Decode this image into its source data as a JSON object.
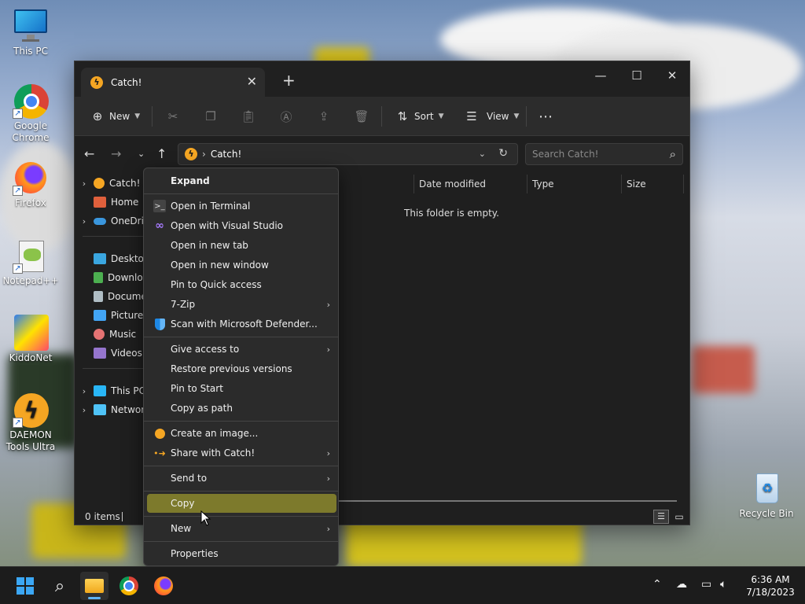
{
  "desktop": {
    "icons": [
      {
        "label": "This PC"
      },
      {
        "label": "Google Chrome"
      },
      {
        "label": "Firefox"
      },
      {
        "label": "Notepad++"
      },
      {
        "label": "KiddoNet"
      },
      {
        "label": "DAEMON Tools Ultra"
      },
      {
        "label": "Recycle Bin"
      }
    ]
  },
  "window": {
    "tab_title": "Catch!",
    "toolbar": {
      "new_label": "New",
      "sort_label": "Sort",
      "view_label": "View"
    },
    "address": {
      "path": "Catch!",
      "search_placeholder": "Search Catch!"
    },
    "nav": {
      "items": [
        {
          "label": "Catch!"
        },
        {
          "label": "Home"
        },
        {
          "label": "OneDriv"
        },
        {
          "label": "Desktop"
        },
        {
          "label": "Downlo"
        },
        {
          "label": "Docume"
        },
        {
          "label": "Pictures"
        },
        {
          "label": "Music"
        },
        {
          "label": "Videos"
        },
        {
          "label": "This PC"
        },
        {
          "label": "Networ"
        }
      ]
    },
    "columns": {
      "date_modified": "Date modified",
      "type": "Type",
      "size": "Size"
    },
    "empty_message": "This folder is empty.",
    "status": {
      "item_count": "0 items"
    }
  },
  "context_menu": {
    "items": [
      {
        "label": "Expand"
      },
      {
        "label": "Open in Terminal"
      },
      {
        "label": "Open with Visual Studio"
      },
      {
        "label": "Open in new tab"
      },
      {
        "label": "Open in new window"
      },
      {
        "label": "Pin to Quick access"
      },
      {
        "label": "7-Zip"
      },
      {
        "label": "Scan with Microsoft Defender..."
      },
      {
        "label": "Give access to"
      },
      {
        "label": "Restore previous versions"
      },
      {
        "label": "Pin to Start"
      },
      {
        "label": "Copy as path"
      },
      {
        "label": "Create an image..."
      },
      {
        "label": "Share with Catch!"
      },
      {
        "label": "Send to"
      },
      {
        "label": "Copy"
      },
      {
        "label": "New"
      },
      {
        "label": "Properties"
      }
    ]
  },
  "taskbar": {
    "time": "6:36 AM",
    "date": "7/18/2023"
  },
  "colors": {
    "accent_highlight": "#7d7a2c",
    "window_bg": "#1f1f1f",
    "menu_bg": "#2b2b2b",
    "catch_orange": "#f5a623"
  }
}
